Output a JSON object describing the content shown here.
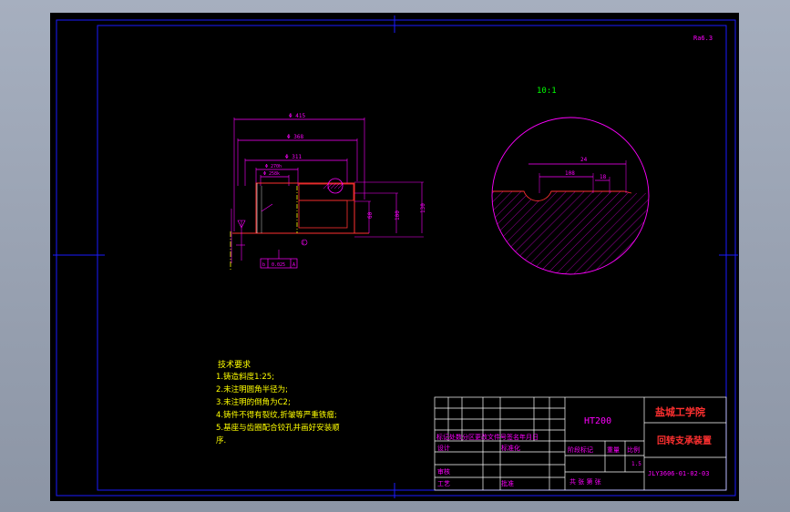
{
  "colors": {
    "background": "#000000",
    "frame": "#1a1aff",
    "geometry": "#ff3030",
    "dimensions": "#ff00ff",
    "centerline": "#ffff00",
    "note_text": "#ffff00",
    "titleblock_lines": "#ffffff",
    "titleblock_text": "#ff00ff",
    "scale_label": "#00ff00"
  },
  "drawing": {
    "corner_label": "Ra6.3",
    "detail_scale_label": "10:1",
    "dimensions": {
      "d1": "Φ 415",
      "d2": "Φ 368",
      "d3": "Φ 311",
      "d4": "Φ 270h",
      "d5": "Φ 258k",
      "h1": "130",
      "h2": "100",
      "h3": "60",
      "tol": "0.025",
      "tol_datum": "A",
      "balloon": "C",
      "detail_w1": "24",
      "detail_w2": "108",
      "detail_w3": "18"
    }
  },
  "notes": {
    "heading": "技术要求",
    "lines": [
      "1.铸造斜度1:25;",
      "2.未注明圆角半径为;",
      "3.未注明的倒角为C2;",
      "4.铸件不得有裂纹,折皱等严重铁瘤;",
      "5.基座与齿圈配合铰孔并画好安装顺",
      "序."
    ]
  },
  "title_block": {
    "material": "HT200",
    "school": "盐城工学院",
    "part_name": "回转支承装置",
    "drawing_no": "JLY3606-01-02-03",
    "scale": "1.5",
    "header_row": "标记处数分区更改文件号签名年月日",
    "designer_label": "设计",
    "standard_label": "标准化",
    "review_label": "审核",
    "process_label": "工艺",
    "approve_label": "批准",
    "stage_label": "阶段标记",
    "weight_label": "重量",
    "ratio_label": "比例",
    "sheets_label": "共 张 第 张"
  }
}
